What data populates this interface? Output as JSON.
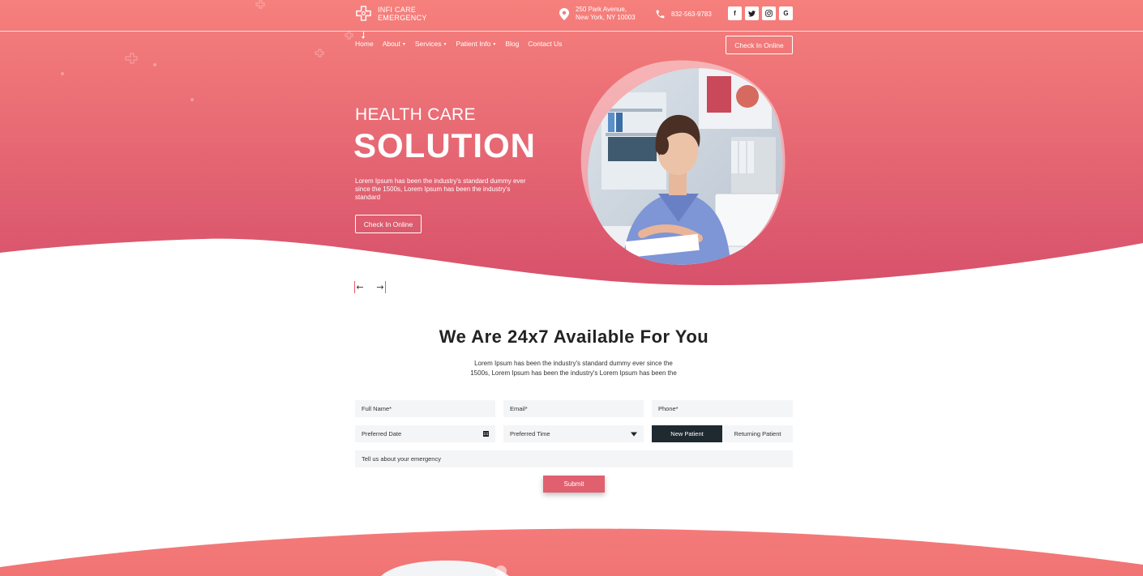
{
  "brand": {
    "name_line1": "INFI CARE",
    "name_line2": "EMERGENCY"
  },
  "contact": {
    "address_line1": "250 Park Avenue,",
    "address_line2": "New York, NY 10003",
    "phone": "832-563-9783"
  },
  "socials": [
    {
      "icon": "facebook-icon",
      "glyph": "f"
    },
    {
      "icon": "twitter-icon",
      "glyph": "t"
    },
    {
      "icon": "instagram-icon",
      "glyph": "◎"
    },
    {
      "icon": "google-icon",
      "glyph": "G"
    }
  ],
  "nav": {
    "items": [
      {
        "label": "Home",
        "has_dropdown": false
      },
      {
        "label": "About",
        "has_dropdown": true
      },
      {
        "label": "Services",
        "has_dropdown": true
      },
      {
        "label": "Patient Info",
        "has_dropdown": true
      },
      {
        "label": "Blog",
        "has_dropdown": false
      },
      {
        "label": "Contact Us",
        "has_dropdown": false
      }
    ],
    "cta_label": "Check In Online"
  },
  "hero": {
    "subtitle": "HEALTH CARE",
    "title": "SOLUTION",
    "text": "Lorem Ipsum has been the industry's standard dummy ever since the 1500s, Lorem Ipsum has been the industry's standard",
    "button_label": "Check In Online",
    "prev_arrow": "←",
    "next_arrow": "→"
  },
  "appointment": {
    "title": "We Are 24x7 Available For You",
    "text": "Lorem Ipsum has been the industry's standard dummy ever since the 1500s, Lorem Ipsum has been the industry's Lorem Ipsum has been the",
    "full_name_placeholder": "Full Name*",
    "email_placeholder": "Email*",
    "phone_placeholder": "Phone*",
    "date_placeholder": "Preferred Date",
    "time_placeholder": "Preferred Time",
    "toggle_new": "New Patient",
    "toggle_returning": "Returning Patient",
    "message_placeholder": "Tell us about your emergency",
    "submit_label": "Submit"
  },
  "colors": {
    "hero_top": "#f6807c",
    "hero_bottom": "#d9546b",
    "accent": "#e0606f",
    "dark": "#1f2a30"
  }
}
